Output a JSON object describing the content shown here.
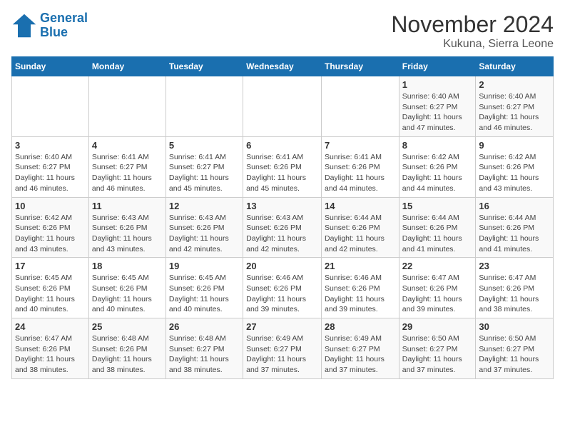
{
  "logo": {
    "line1": "General",
    "line2": "Blue"
  },
  "title": "November 2024",
  "location": "Kukuna, Sierra Leone",
  "days_of_week": [
    "Sunday",
    "Monday",
    "Tuesday",
    "Wednesday",
    "Thursday",
    "Friday",
    "Saturday"
  ],
  "weeks": [
    [
      {
        "day": "",
        "info": ""
      },
      {
        "day": "",
        "info": ""
      },
      {
        "day": "",
        "info": ""
      },
      {
        "day": "",
        "info": ""
      },
      {
        "day": "",
        "info": ""
      },
      {
        "day": "1",
        "info": "Sunrise: 6:40 AM\nSunset: 6:27 PM\nDaylight: 11 hours and 47 minutes."
      },
      {
        "day": "2",
        "info": "Sunrise: 6:40 AM\nSunset: 6:27 PM\nDaylight: 11 hours and 46 minutes."
      }
    ],
    [
      {
        "day": "3",
        "info": "Sunrise: 6:40 AM\nSunset: 6:27 PM\nDaylight: 11 hours and 46 minutes."
      },
      {
        "day": "4",
        "info": "Sunrise: 6:41 AM\nSunset: 6:27 PM\nDaylight: 11 hours and 46 minutes."
      },
      {
        "day": "5",
        "info": "Sunrise: 6:41 AM\nSunset: 6:27 PM\nDaylight: 11 hours and 45 minutes."
      },
      {
        "day": "6",
        "info": "Sunrise: 6:41 AM\nSunset: 6:26 PM\nDaylight: 11 hours and 45 minutes."
      },
      {
        "day": "7",
        "info": "Sunrise: 6:41 AM\nSunset: 6:26 PM\nDaylight: 11 hours and 44 minutes."
      },
      {
        "day": "8",
        "info": "Sunrise: 6:42 AM\nSunset: 6:26 PM\nDaylight: 11 hours and 44 minutes."
      },
      {
        "day": "9",
        "info": "Sunrise: 6:42 AM\nSunset: 6:26 PM\nDaylight: 11 hours and 43 minutes."
      }
    ],
    [
      {
        "day": "10",
        "info": "Sunrise: 6:42 AM\nSunset: 6:26 PM\nDaylight: 11 hours and 43 minutes."
      },
      {
        "day": "11",
        "info": "Sunrise: 6:43 AM\nSunset: 6:26 PM\nDaylight: 11 hours and 43 minutes."
      },
      {
        "day": "12",
        "info": "Sunrise: 6:43 AM\nSunset: 6:26 PM\nDaylight: 11 hours and 42 minutes."
      },
      {
        "day": "13",
        "info": "Sunrise: 6:43 AM\nSunset: 6:26 PM\nDaylight: 11 hours and 42 minutes."
      },
      {
        "day": "14",
        "info": "Sunrise: 6:44 AM\nSunset: 6:26 PM\nDaylight: 11 hours and 42 minutes."
      },
      {
        "day": "15",
        "info": "Sunrise: 6:44 AM\nSunset: 6:26 PM\nDaylight: 11 hours and 41 minutes."
      },
      {
        "day": "16",
        "info": "Sunrise: 6:44 AM\nSunset: 6:26 PM\nDaylight: 11 hours and 41 minutes."
      }
    ],
    [
      {
        "day": "17",
        "info": "Sunrise: 6:45 AM\nSunset: 6:26 PM\nDaylight: 11 hours and 40 minutes."
      },
      {
        "day": "18",
        "info": "Sunrise: 6:45 AM\nSunset: 6:26 PM\nDaylight: 11 hours and 40 minutes."
      },
      {
        "day": "19",
        "info": "Sunrise: 6:45 AM\nSunset: 6:26 PM\nDaylight: 11 hours and 40 minutes."
      },
      {
        "day": "20",
        "info": "Sunrise: 6:46 AM\nSunset: 6:26 PM\nDaylight: 11 hours and 39 minutes."
      },
      {
        "day": "21",
        "info": "Sunrise: 6:46 AM\nSunset: 6:26 PM\nDaylight: 11 hours and 39 minutes."
      },
      {
        "day": "22",
        "info": "Sunrise: 6:47 AM\nSunset: 6:26 PM\nDaylight: 11 hours and 39 minutes."
      },
      {
        "day": "23",
        "info": "Sunrise: 6:47 AM\nSunset: 6:26 PM\nDaylight: 11 hours and 38 minutes."
      }
    ],
    [
      {
        "day": "24",
        "info": "Sunrise: 6:47 AM\nSunset: 6:26 PM\nDaylight: 11 hours and 38 minutes."
      },
      {
        "day": "25",
        "info": "Sunrise: 6:48 AM\nSunset: 6:26 PM\nDaylight: 11 hours and 38 minutes."
      },
      {
        "day": "26",
        "info": "Sunrise: 6:48 AM\nSunset: 6:27 PM\nDaylight: 11 hours and 38 minutes."
      },
      {
        "day": "27",
        "info": "Sunrise: 6:49 AM\nSunset: 6:27 PM\nDaylight: 11 hours and 37 minutes."
      },
      {
        "day": "28",
        "info": "Sunrise: 6:49 AM\nSunset: 6:27 PM\nDaylight: 11 hours and 37 minutes."
      },
      {
        "day": "29",
        "info": "Sunrise: 6:50 AM\nSunset: 6:27 PM\nDaylight: 11 hours and 37 minutes."
      },
      {
        "day": "30",
        "info": "Sunrise: 6:50 AM\nSunset: 6:27 PM\nDaylight: 11 hours and 37 minutes."
      }
    ]
  ]
}
